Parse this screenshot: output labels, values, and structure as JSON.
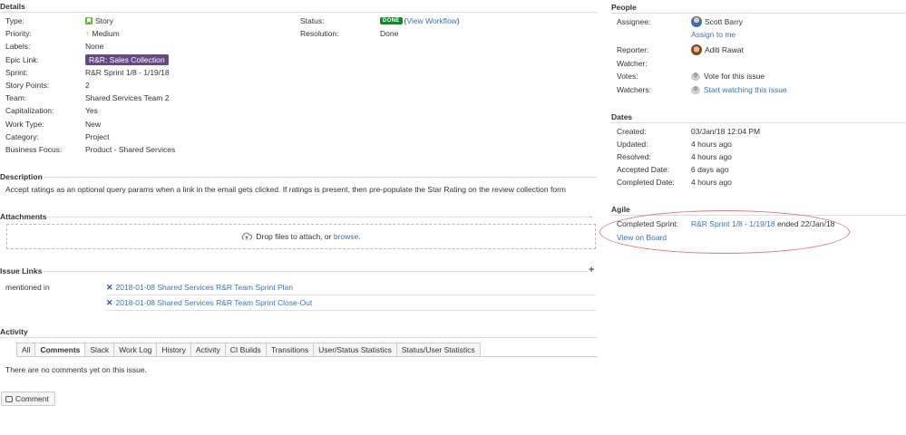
{
  "details": {
    "title": "Details",
    "left_fields": [
      {
        "label": "Type:",
        "value": "Story"
      },
      {
        "label": "Priority:",
        "value": "Medium"
      },
      {
        "label": "Labels:",
        "value": "None"
      },
      {
        "label": "Epic Link:",
        "value": "R&R: Sales Collection"
      },
      {
        "label": "Sprint:",
        "value": "R&R Sprint 1/8 - 1/19/18"
      },
      {
        "label": "Story Points:",
        "value": "2"
      },
      {
        "label": "Team:",
        "value": "Shared Services Team 2"
      },
      {
        "label": "Capitalization:",
        "value": "Yes"
      },
      {
        "label": "Work Type:",
        "value": "New"
      },
      {
        "label": "Category:",
        "value": "Project"
      },
      {
        "label": "Business Focus:",
        "value": "Product - Shared Services"
      }
    ],
    "status_label": "Status:",
    "status_badge": "DONE",
    "view_workflow": "View Workflow",
    "resolution_label": "Resolution:",
    "resolution_value": "Done"
  },
  "description": {
    "title": "Description",
    "text": "Accept ratings as an optional query params when a link in the email gets clicked. If ratings is present, then pre-populate the Star Rating on the review collection form"
  },
  "attachments": {
    "title": "Attachments",
    "drop_text": "Drop files to attach, or",
    "browse": "browse."
  },
  "issue_links": {
    "title": "Issue Links",
    "relation": "mentioned in",
    "items": [
      "2018-01-08 Shared Services R&R Team Sprint Plan",
      "2018-01-08 Shared Services R&R Team Sprint Close-Out"
    ]
  },
  "activity": {
    "title": "Activity",
    "tabs": [
      "All",
      "Comments",
      "Slack",
      "Work Log",
      "History",
      "Activity",
      "CI Builds",
      "Transitions",
      "User/Status Statistics",
      "Status/User Statistics"
    ],
    "active_tab": "Comments",
    "empty_text": "There are no comments yet on this issue.",
    "comment_button": "Comment"
  },
  "people": {
    "title": "People",
    "assignee_label": "Assignee:",
    "assignee": "Scott Barry",
    "assign_to_me": "Assign to me",
    "reporter_label": "Reporter:",
    "reporter": "Aditi Rawat",
    "watcher_label": "Watcher:",
    "votes_label": "Votes:",
    "votes_count": "0",
    "vote_link": "Vote for this issue",
    "watchers_label": "Watchers:",
    "watchers_count": "0",
    "watch_link": "Start watching this issue"
  },
  "dates": {
    "title": "Dates",
    "rows": [
      {
        "label": "Created:",
        "value": "03/Jan/18 12:04 PM"
      },
      {
        "label": "Updated:",
        "value": "4 hours ago"
      },
      {
        "label": "Resolved:",
        "value": "4 hours ago"
      },
      {
        "label": "Accepted Date:",
        "value": "6 days ago"
      },
      {
        "label": "Completed Date:",
        "value": "4 hours ago"
      }
    ]
  },
  "agile": {
    "title": "Agile",
    "completed_sprint_label": "Completed Sprint:",
    "sprint_link": "R&R Sprint 1/8 - 1/19/18",
    "sprint_suffix": "ended 22/Jan/18",
    "view_on_board": "View on Board"
  }
}
